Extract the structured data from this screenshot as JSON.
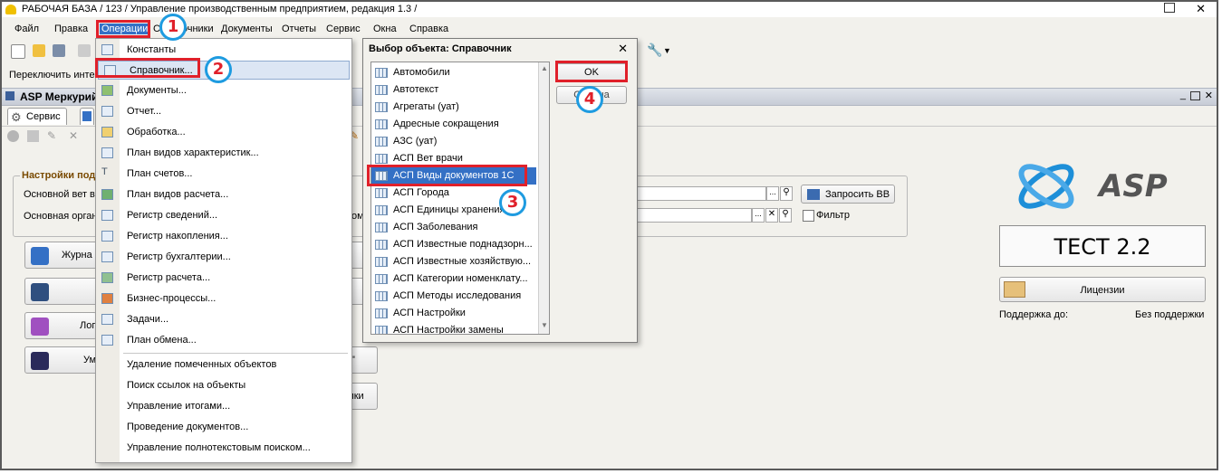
{
  "window": {
    "title": "РАБОЧАЯ БАЗА / 123 /  Управление производственным предприятием, редакция 1.3 /"
  },
  "menubar": {
    "items": [
      "Файл",
      "Правка",
      "Операции",
      "Справочники",
      "Документы",
      "Отчеты",
      "Сервис",
      "Окна",
      "Справка"
    ]
  },
  "switchbar": {
    "label": "Переключить инте"
  },
  "doc": {
    "title": "ASP Меркурий",
    "tab_service": "Сервис"
  },
  "settings": {
    "group_title": "Настройки под",
    "row1_label": "Основной вет в",
    "row2_label": "Основная орган",
    "row2_tail": "ом",
    "request_button": "Запросить ВВ",
    "filter_label": "Фильтр"
  },
  "left_buttons": [
    {
      "label": "Журна",
      "tail": "ля"
    },
    {
      "label": "",
      "tail": "во"
    },
    {
      "label": "Лог",
      "tail": ""
    },
    {
      "label": "Ум",
      "tail": "\""
    },
    {
      "label": "",
      "tail": "мики"
    }
  ],
  "ops_menu": {
    "items": [
      {
        "label": "Константы",
        "icon": "constants-icon"
      },
      {
        "label": "Справочник...",
        "icon": "catalog-icon",
        "selected": true
      },
      {
        "label": "Документы...",
        "icon": "documents-icon"
      },
      {
        "label": "Отчет...",
        "icon": "report-icon"
      },
      {
        "label": "Обработка...",
        "icon": "processing-icon"
      },
      {
        "label": "План видов характеристик...",
        "icon": "char-plan-icon"
      },
      {
        "label": "План счетов...",
        "icon": "accounts-plan-icon"
      },
      {
        "label": "План видов расчета...",
        "icon": "calc-plan-icon"
      },
      {
        "label": "Регистр сведений...",
        "icon": "info-register-icon"
      },
      {
        "label": "Регистр накопления...",
        "icon": "accum-register-icon"
      },
      {
        "label": "Регистр бухгалтерии...",
        "icon": "acc-register-icon"
      },
      {
        "label": "Регистр расчета...",
        "icon": "calc-register-icon"
      },
      {
        "label": "Бизнес-процессы...",
        "icon": "business-process-icon"
      },
      {
        "label": "Задачи...",
        "icon": "tasks-icon"
      },
      {
        "label": "План обмена...",
        "icon": "exchange-plan-icon"
      }
    ],
    "service_items": [
      "Удаление помеченных объектов",
      "Поиск ссылок на объекты",
      "Управление итогами...",
      "Проведение документов...",
      "Управление полнотекстовым поиском..."
    ]
  },
  "dialog": {
    "title": "Выбор объекта: Справочник",
    "ok_label": "OK",
    "cancel_label": "Отмена",
    "items": [
      "Автомобили",
      "Автотекст",
      "Агрегаты (уат)",
      "Адресные сокращения",
      "АЗС (уат)",
      "АСП Вет врачи",
      "АСП Виды документов 1С",
      "АСП Города",
      "АСП Единицы хранения",
      "АСП Заболевания",
      "АСП Известные поднадзорн...",
      "АСП Известные хозяйствую...",
      "АСП Категории номенклату...",
      "АСП Методы исследования",
      "АСП Настройки",
      "АСП Настройки замены"
    ],
    "selected_index": 6
  },
  "right_panel": {
    "logo_text": "ASP",
    "test_label": "ТЕСТ 2.2",
    "license_button": "Лицензии",
    "support_label": "Поддержка до:",
    "support_value": "Без поддержки"
  },
  "steps": [
    "1",
    "2",
    "3",
    "4"
  ],
  "colors": {
    "highlight_red": "#e0202a",
    "badge_blue": "#1e9be0",
    "selection_blue": "#3470c5"
  }
}
